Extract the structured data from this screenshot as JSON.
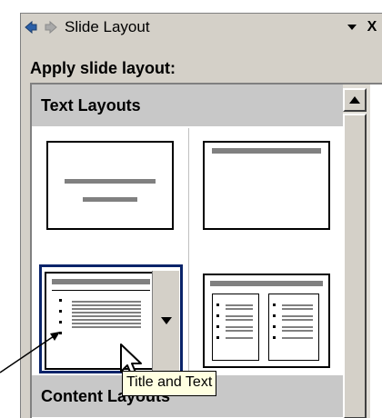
{
  "pane": {
    "title": "Slide Layout",
    "back_icon": "back-arrow-icon",
    "forward_icon": "forward-arrow-icon",
    "menu_icon": "chevron-down-icon",
    "close_label": "X",
    "apply_label": "Apply slide layout:"
  },
  "sections": {
    "text_layouts": "Text Layouts",
    "content_layouts": "Content Layouts"
  },
  "layouts": [
    {
      "name": "Title Slide"
    },
    {
      "name": "Title Only"
    },
    {
      "name": "Title and Text",
      "selected": true
    },
    {
      "name": "Title and 2-Column Text"
    }
  ],
  "tooltip": "Title and Text",
  "colors": {
    "selection": "#0a246a",
    "header_bg": "#c8c8c8",
    "tooltip_bg": "#ffffe1"
  }
}
